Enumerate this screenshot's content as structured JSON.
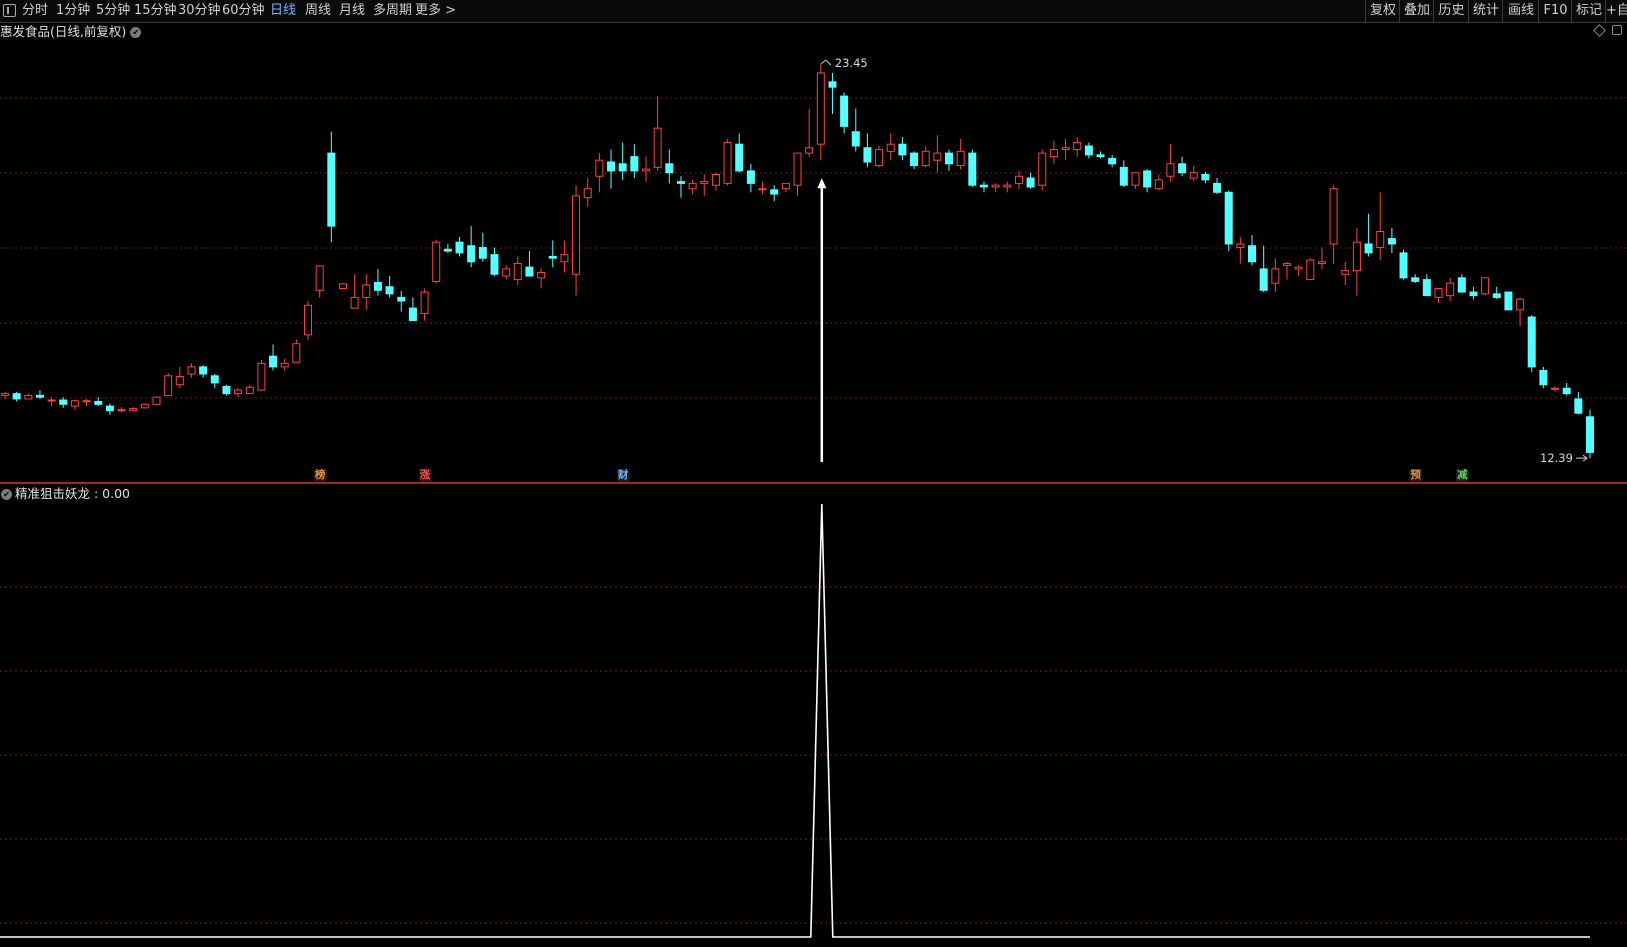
{
  "toolbar": {
    "periods": [
      "分时",
      "1分钟",
      "5分钟",
      "15分钟",
      "30分钟",
      "60分钟",
      "日线",
      "周线",
      "月线",
      "多周期",
      "更多 >"
    ],
    "active_period": "日线",
    "right_buttons": [
      "复权",
      "叠加",
      "历史",
      "统计",
      "画线",
      "F10",
      "标记",
      "+自"
    ]
  },
  "stock": {
    "title": "惠发食品(日线,前复权)",
    "high_label": "23.45",
    "low_label": "12.39"
  },
  "event_tags": [
    {
      "text": "榜",
      "color": "#e8913a"
    },
    {
      "text": "涨",
      "color": "#ff4d4d"
    },
    {
      "text": "财",
      "color": "#6fb7ff"
    },
    {
      "text": "预",
      "color": "#e8913a"
    },
    {
      "text": "减",
      "color": "#5ccc5c"
    }
  ],
  "indicator": {
    "title": "精准狙击妖龙 : 0.00"
  },
  "colors": {
    "up": "#ff4040",
    "down": "#54ffff",
    "grid": "#6e1a1a",
    "signal": "#ffffff"
  },
  "chart_data": {
    "type": "candlestick",
    "ohlc": [
      [
        14.15,
        14.25,
        14.05,
        14.2
      ],
      [
        14.2,
        14.25,
        13.98,
        14.05
      ],
      [
        14.05,
        14.2,
        14.05,
        14.15
      ],
      [
        14.15,
        14.3,
        14.05,
        14.1
      ],
      [
        14.0,
        14.1,
        13.85,
        14.02
      ],
      [
        14.02,
        14.1,
        13.8,
        13.9
      ],
      [
        13.85,
        14.02,
        13.75,
        14.0
      ],
      [
        14.0,
        14.05,
        13.85,
        14.0
      ],
      [
        13.98,
        14.1,
        13.85,
        13.9
      ],
      [
        13.85,
        13.92,
        13.6,
        13.72
      ],
      [
        13.72,
        13.82,
        13.68,
        13.75
      ],
      [
        13.72,
        13.82,
        13.7,
        13.78
      ],
      [
        13.8,
        13.92,
        13.8,
        13.9
      ],
      [
        13.9,
        14.1,
        13.9,
        14.1
      ],
      [
        14.15,
        14.78,
        14.15,
        14.7
      ],
      [
        14.45,
        14.95,
        14.35,
        14.68
      ],
      [
        14.75,
        15.05,
        14.65,
        14.95
      ],
      [
        14.95,
        15.0,
        14.65,
        14.75
      ],
      [
        14.7,
        14.75,
        14.35,
        14.5
      ],
      [
        14.4,
        14.45,
        14.15,
        14.2
      ],
      [
        14.2,
        14.35,
        14.1,
        14.3
      ],
      [
        14.2,
        14.45,
        14.2,
        14.38
      ],
      [
        14.3,
        15.15,
        14.28,
        15.05
      ],
      [
        15.25,
        15.58,
        14.85,
        14.95
      ],
      [
        14.95,
        15.18,
        14.85,
        15.05
      ],
      [
        15.08,
        15.72,
        15.08,
        15.6
      ],
      [
        15.85,
        16.8,
        15.7,
        16.68
      ],
      [
        17.1,
        17.8,
        16.9,
        17.78
      ],
      [
        20.95,
        21.55,
        18.45,
        18.9
      ],
      [
        17.15,
        17.3,
        17.15,
        17.28
      ],
      [
        16.6,
        17.55,
        16.6,
        16.9
      ],
      [
        16.9,
        17.55,
        16.55,
        17.25
      ],
      [
        17.32,
        17.7,
        16.95,
        17.1
      ],
      [
        17.2,
        17.5,
        16.9,
        17.0
      ],
      [
        16.9,
        17.08,
        16.5,
        16.8
      ],
      [
        16.6,
        16.9,
        16.25,
        16.25
      ],
      [
        16.45,
        17.15,
        16.25,
        17.05
      ],
      [
        17.35,
        18.52,
        17.3,
        18.45
      ],
      [
        18.25,
        18.4,
        18.15,
        18.2
      ],
      [
        18.45,
        18.6,
        18.05,
        18.15
      ],
      [
        18.35,
        18.9,
        17.75,
        17.9
      ],
      [
        18.3,
        18.72,
        17.9,
        18.0
      ],
      [
        18.1,
        18.3,
        17.5,
        17.55
      ],
      [
        17.5,
        17.8,
        17.4,
        17.7
      ],
      [
        17.4,
        18.05,
        17.25,
        17.85
      ],
      [
        17.75,
        18.2,
        17.5,
        17.5
      ],
      [
        17.45,
        17.72,
        17.15,
        17.6
      ],
      [
        18.05,
        18.5,
        17.75,
        18.0
      ],
      [
        17.9,
        18.5,
        17.6,
        18.1
      ],
      [
        17.55,
        20.05,
        16.95,
        19.75
      ],
      [
        19.7,
        20.25,
        19.45,
        19.95
      ],
      [
        20.3,
        20.95,
        19.85,
        20.75
      ],
      [
        20.7,
        21.05,
        19.95,
        20.45
      ],
      [
        20.65,
        21.25,
        20.2,
        20.45
      ],
      [
        20.85,
        21.2,
        20.25,
        20.45
      ],
      [
        20.45,
        20.85,
        20.15,
        20.5
      ],
      [
        20.55,
        22.55,
        20.45,
        21.65
      ],
      [
        20.65,
        21.05,
        20.1,
        20.4
      ],
      [
        20.15,
        20.3,
        19.7,
        20.1
      ],
      [
        19.95,
        20.2,
        19.8,
        20.1
      ],
      [
        20.1,
        20.35,
        19.75,
        20.15
      ],
      [
        20.05,
        20.4,
        19.9,
        20.35
      ],
      [
        20.1,
        21.35,
        20.05,
        21.25
      ],
      [
        21.2,
        21.5,
        20.4,
        20.45
      ],
      [
        20.45,
        20.65,
        19.85,
        20.1
      ],
      [
        19.95,
        20.15,
        19.8,
        19.95
      ],
      [
        19.92,
        20.05,
        19.6,
        19.8
      ],
      [
        19.95,
        20.1,
        19.85,
        20.1
      ],
      [
        20.05,
        20.35,
        19.75,
        20.95
      ],
      [
        20.95,
        22.2,
        20.85,
        21.1
      ],
      [
        21.2,
        23.45,
        20.75,
        23.2
      ],
      [
        22.95,
        23.2,
        22.05,
        22.8
      ],
      [
        22.55,
        22.65,
        21.5,
        21.7
      ],
      [
        21.55,
        22.2,
        21.0,
        21.15
      ],
      [
        21.1,
        21.5,
        20.55,
        20.7
      ],
      [
        20.6,
        21.15,
        20.55,
        21.05
      ],
      [
        21.0,
        21.5,
        20.75,
        21.2
      ],
      [
        21.2,
        21.4,
        20.75,
        20.9
      ],
      [
        20.95,
        21.0,
        20.5,
        20.6
      ],
      [
        20.6,
        21.15,
        20.55,
        21.0
      ],
      [
        20.75,
        21.45,
        20.4,
        20.95
      ],
      [
        20.95,
        21.05,
        20.45,
        20.65
      ],
      [
        20.6,
        21.35,
        20.5,
        21.0
      ],
      [
        20.95,
        21.05,
        20.0,
        20.05
      ],
      [
        20.05,
        20.15,
        19.85,
        20.0
      ],
      [
        20.0,
        20.1,
        19.85,
        20.05
      ],
      [
        20.0,
        20.15,
        19.85,
        20.05
      ],
      [
        20.1,
        20.45,
        19.95,
        20.3
      ],
      [
        20.25,
        20.4,
        19.95,
        20.0
      ],
      [
        20.05,
        21.05,
        19.9,
        20.95
      ],
      [
        20.85,
        21.3,
        20.65,
        21.05
      ],
      [
        21.05,
        21.35,
        20.75,
        21.1
      ],
      [
        21.05,
        21.4,
        20.85,
        21.25
      ],
      [
        21.15,
        21.25,
        20.8,
        20.9
      ],
      [
        20.9,
        21.0,
        20.8,
        20.85
      ],
      [
        20.8,
        20.9,
        20.55,
        20.65
      ],
      [
        20.55,
        20.75,
        20.0,
        20.05
      ],
      [
        20.05,
        20.35,
        19.95,
        20.4
      ],
      [
        20.45,
        20.5,
        19.85,
        20.0
      ],
      [
        19.95,
        20.35,
        19.9,
        20.2
      ],
      [
        20.3,
        21.2,
        20.15,
        20.65
      ],
      [
        20.65,
        20.85,
        20.3,
        20.4
      ],
      [
        20.25,
        20.6,
        20.15,
        20.4
      ],
      [
        20.35,
        20.42,
        20.1,
        20.2
      ],
      [
        20.1,
        20.25,
        19.8,
        19.85
      ],
      [
        19.85,
        19.9,
        18.2,
        18.4
      ],
      [
        18.3,
        18.6,
        17.85,
        18.4
      ],
      [
        18.35,
        18.65,
        17.8,
        17.9
      ],
      [
        17.7,
        18.35,
        17.05,
        17.1
      ],
      [
        17.3,
        18.0,
        17.05,
        17.7
      ],
      [
        17.8,
        17.9,
        17.4,
        17.85
      ],
      [
        17.7,
        17.8,
        17.5,
        17.75
      ],
      [
        17.4,
        18.0,
        17.4,
        17.95
      ],
      [
        17.85,
        18.3,
        17.7,
        17.9
      ],
      [
        18.4,
        20.05,
        17.85,
        19.95
      ],
      [
        17.55,
        17.9,
        17.25,
        17.65
      ],
      [
        17.65,
        18.85,
        16.95,
        18.45
      ],
      [
        18.4,
        19.25,
        18.05,
        18.15
      ],
      [
        18.3,
        19.85,
        17.95,
        18.75
      ],
      [
        18.55,
        18.85,
        18.15,
        18.4
      ],
      [
        18.15,
        18.25,
        17.4,
        17.45
      ],
      [
        17.45,
        17.55,
        17.3,
        17.35
      ],
      [
        17.4,
        17.55,
        16.95,
        16.95
      ],
      [
        16.9,
        17.15,
        16.75,
        17.15
      ],
      [
        16.95,
        17.45,
        16.8,
        17.3
      ],
      [
        17.45,
        17.55,
        17.05,
        17.05
      ],
      [
        17.05,
        17.2,
        16.85,
        16.95
      ],
      [
        17.0,
        17.45,
        16.95,
        17.45
      ],
      [
        17.0,
        17.2,
        16.85,
        16.9
      ],
      [
        17.05,
        17.05,
        16.55,
        16.55
      ],
      [
        16.55,
        16.9,
        16.1,
        16.85
      ],
      [
        16.35,
        16.4,
        14.8,
        14.95
      ],
      [
        14.85,
        14.95,
        14.35,
        14.45
      ],
      [
        14.35,
        14.4,
        14.25,
        14.35
      ],
      [
        14.35,
        14.5,
        14.15,
        14.2
      ],
      [
        14.05,
        14.25,
        13.62,
        13.65
      ],
      [
        13.55,
        13.75,
        12.39,
        12.55
      ]
    ],
    "signal": [
      {
        "index": 70,
        "value": 1
      }
    ],
    "price_range": [
      12.0,
      23.9
    ],
    "high": 23.45,
    "low": 12.39
  }
}
